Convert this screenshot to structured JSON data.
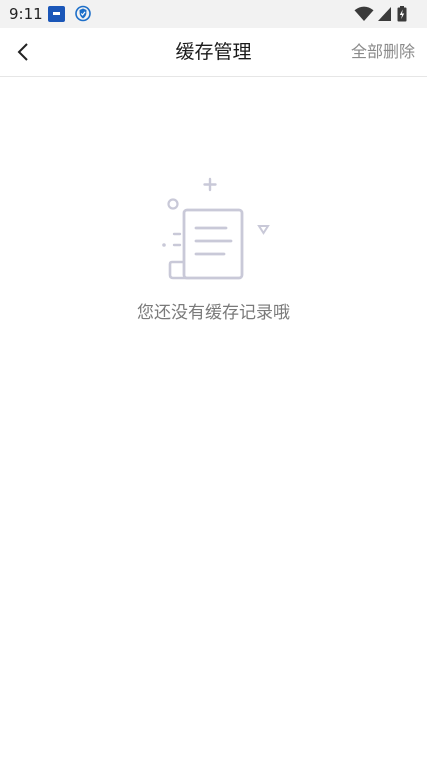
{
  "status_bar": {
    "time": "9:11",
    "notification_icons": [
      "app-notification-icon",
      "shield-notification-icon"
    ],
    "system_icons": [
      "wifi-icon",
      "cellular-signal-icon",
      "battery-charging-icon"
    ]
  },
  "header": {
    "back_icon": "chevron-left-icon",
    "title": "缓存管理",
    "delete_all_label": "全部删除"
  },
  "empty_state": {
    "illustration_icon": "empty-document-icon",
    "message": "您还没有缓存记录哦"
  },
  "colors": {
    "status_bar_bg": "#f2f2f2",
    "illustration_stroke": "#c9c9d8",
    "secondary_text": "#7a7a7a",
    "action_text": "#8a8a8a"
  }
}
